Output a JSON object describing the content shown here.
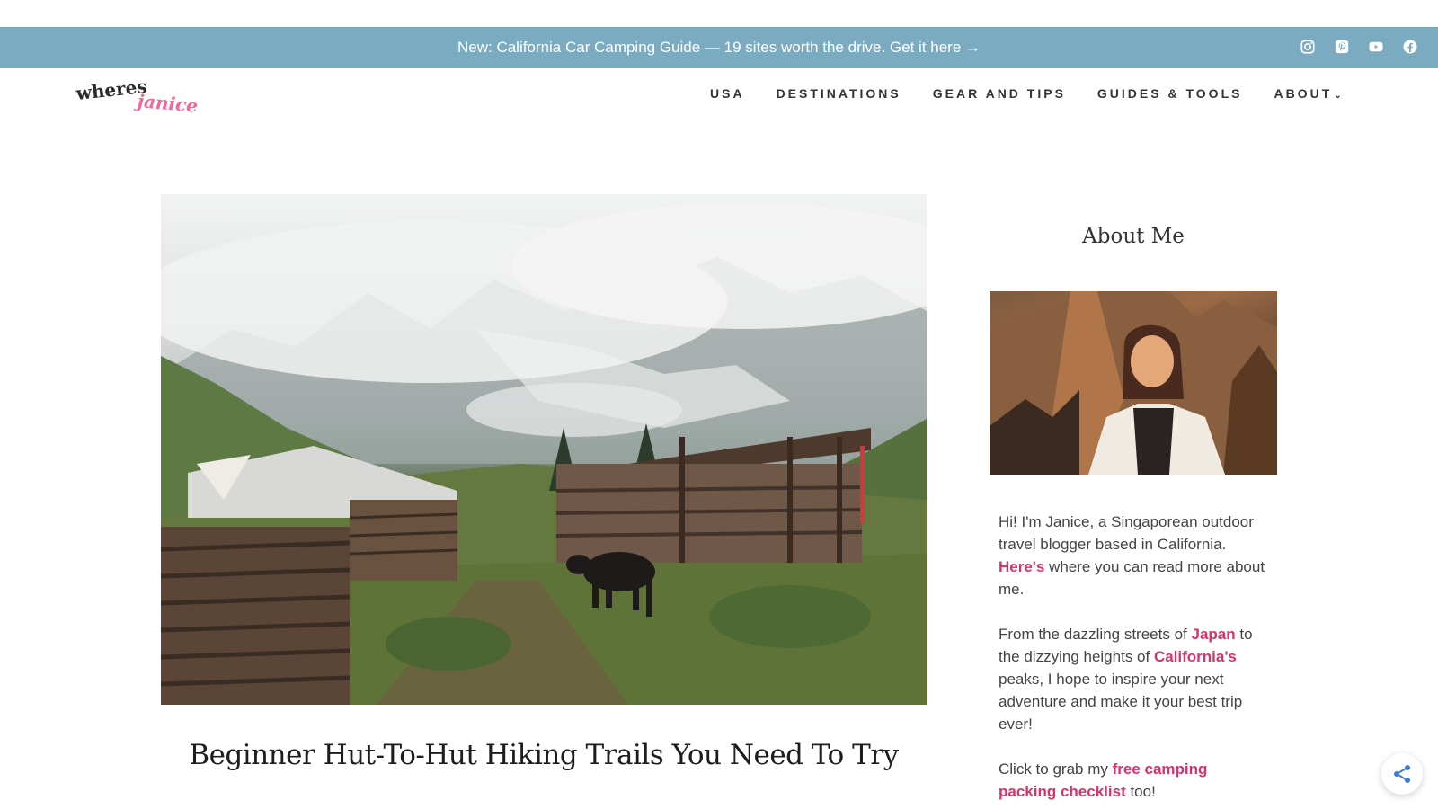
{
  "announcement": {
    "text": "New: California Car Camping Guide — 19 sites worth the drive. Get it here →"
  },
  "socials": {
    "items": [
      {
        "icon": "instagram-icon"
      },
      {
        "icon": "pinterest-icon"
      },
      {
        "icon": "youtube-icon"
      },
      {
        "icon": "facebook-icon"
      }
    ]
  },
  "logo": {
    "part1": "wheres",
    "part2": "janice"
  },
  "nav": {
    "items": [
      {
        "label": "USA"
      },
      {
        "label": "DESTINATIONS"
      },
      {
        "label": "GEAR AND TIPS"
      },
      {
        "label": "GUIDES & TOOLS"
      },
      {
        "label": "ABOUT"
      }
    ]
  },
  "article": {
    "title": "Beginner Hut-To-Hut Hiking Trails You Need To Try"
  },
  "sidebar": {
    "title": "About Me",
    "p1_pre": "Hi! I'm Janice, a Singaporean outdoor travel blogger based in California. ",
    "p1_link": "Here's",
    "p1_post": " where you can read more about me.",
    "p2_pre": "From the dazzling streets of ",
    "p2_link1": "Japan",
    "p2_mid": " to the dizzying heights of ",
    "p2_link2": "California's",
    "p2_post": " peaks, I hope to inspire your next adventure and make it your best trip ever!",
    "p3_pre": "Click to grab my ",
    "p3_link": "free camping packing checklist",
    "p3_post": " too!"
  },
  "colors": {
    "announcement_bg": "#7aabc1",
    "link_pink": "#d6336c",
    "logo_pink": "#f0679c"
  }
}
